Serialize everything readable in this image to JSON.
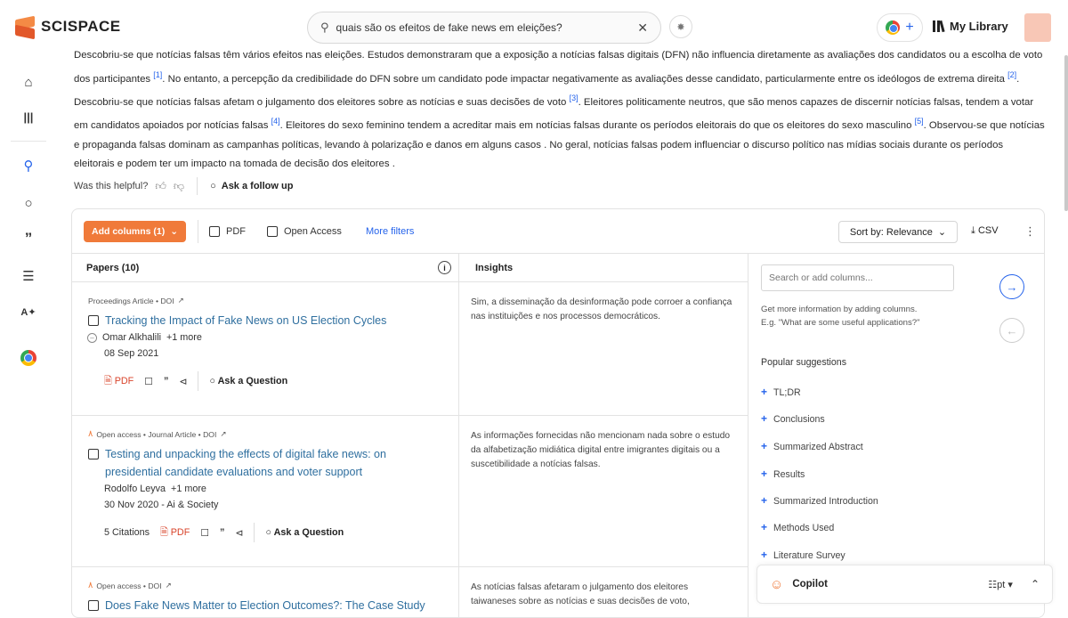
{
  "header": {
    "brand": "SCISPACE",
    "search_value": "quais são os efeitos de fake news em eleições?",
    "search_placeholder": "Search",
    "my_library": "My Library",
    "extension_plus": "+"
  },
  "rail": {
    "items": [
      "home-icon",
      "library-icon",
      "search-icon",
      "chat-icon",
      "quote-icon",
      "list-icon",
      "ai-writer-icon",
      "chrome-icon"
    ]
  },
  "answer": {
    "s1": "Descobriu-se que notícias falsas têm vários efeitos nas eleições. Estudos demonstraram que a exposição a notícias falsas digitais (DFN) não influencia diretamente as avaliações dos candidatos ou a escolha de voto dos participantes ",
    "r1": "[1]",
    "s2": ". No entanto, a percepção da credibilidade do DFN sobre um candidato pode impactar negativamente as avaliações desse candidato, particularmente entre os ideólogos de extrema direita ",
    "r2": "[2]",
    "s3": ". Descobriu-se que notícias falsas afetam o julgamento dos eleitores sobre as notícias e suas decisões de voto ",
    "r3": "[3]",
    "s4": ". Eleitores politicamente neutros, que são menos capazes de discernir notícias falsas, tendem a votar em candidatos apoiados por notícias falsas ",
    "r4": "[4]",
    "s5": ". Eleitores do sexo feminino tendem a acreditar mais em notícias falsas durante os períodos eleitorais do que os eleitores do sexo masculino ",
    "r5": "[5]",
    "s6": ". Observou-se que notícias e propaganda falsas dominam as campanhas políticas, levando à polarização e danos em alguns casos . No geral, notícias falsas podem influenciar o discurso político nas mídias sociais durante os períodos eleitorais e podem ter um impacto na tomada de decisão dos eleitores ."
  },
  "feedback": {
    "helpful": "Was this helpful?",
    "follow_up": "Ask a follow up"
  },
  "toolbar": {
    "add_columns": "Add columns (1)",
    "pdf": "PDF",
    "open_access": "Open Access",
    "more_filters": "More filters",
    "sort": "Sort by: Relevance",
    "csv": "CSV"
  },
  "columns": {
    "papers": "Papers (10)",
    "insights": "Insights"
  },
  "papers": [
    {
      "meta": "Proceedings Article • DOI",
      "title": "Tracking the Impact of Fake News on US Election Cycles",
      "authors": "Omar Alkhalili",
      "more": "+1 more",
      "date": "08 Sep 2021",
      "citations": "",
      "pdf": "PDF",
      "ask": "Ask a Question",
      "insight": "Sim, a disseminação da desinformação pode corroer a confiança nas instituições e nos processos democráticos."
    },
    {
      "meta": "Open access • Journal Article • DOI",
      "title": "Testing and unpacking the effects of digital fake news: on presidential candidate evaluations and voter support",
      "authors": "Rodolfo Leyva",
      "more": "+1 more",
      "date": "30 Nov 2020 - Ai & Society",
      "citations": "5 Citations",
      "pdf": "PDF",
      "ask": "Ask a Question",
      "insight": "As informações fornecidas não mencionam nada sobre o estudo da alfabetização midiática digital entre imigrantes digitais ou a suscetibilidade a notícias falsas."
    },
    {
      "meta": "Open access • DOI",
      "title": "Does Fake News Matter to Election Outcomes?: The Case Study",
      "insight": "As notícias falsas afetaram o julgamento dos eleitores taiwaneses sobre as notícias e suas decisões de voto,"
    }
  ],
  "panel": {
    "placeholder": "Search or add columns...",
    "hint1": "Get more information by adding columns.",
    "hint2": "E.g. \"What are some useful applications?\"",
    "popular": "Popular suggestions",
    "suggestions": [
      "TL;DR",
      "Conclusions",
      "Summarized Abstract",
      "Results",
      "Summarized Introduction",
      "Methods Used",
      "Literature Survey"
    ]
  },
  "copilot": {
    "label": "Copilot",
    "lang": "pt"
  },
  "colors": {
    "accent": "#f07a3a",
    "link": "#2563eb",
    "title": "#2f6f9f"
  }
}
